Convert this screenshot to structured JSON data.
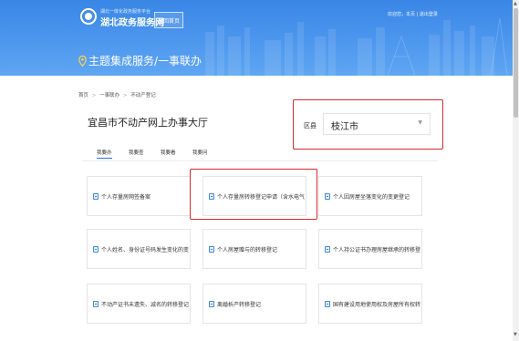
{
  "header": {
    "logo_small_text": "湖北一体化政务服务平台",
    "logo_big_text": "湖北政务服务网",
    "home_button": "返回首页",
    "top_links": "欢迎您，本页 | 退出登录",
    "service_title": "主题集成服务/一事联办"
  },
  "breadcrumb": {
    "items": [
      "首页",
      "一事联办",
      "不动产登记"
    ],
    "separator": ">"
  },
  "hall_title": "宜昌市不动产网上办事大厅",
  "region": {
    "label": "区县",
    "value": "枝江市"
  },
  "tabs": [
    "我要办",
    "我要查",
    "我要看",
    "我要问"
  ],
  "cards": [
    "个人存量房网签备案",
    "个人存量房转移登记申请（含水电气",
    "个人因房屋坐落变化的变更登记",
    "个人姓名、身份证号码发生变化的变",
    "个人房屋赠与的转移登记",
    "个人持公证书办理房屋继承的转移登",
    "不动产证书未遗失、减名的转移登记",
    "离婚析产转移登记",
    "国有建设用地使用权及房屋所有权转"
  ],
  "colors": {
    "header_blue": "#3a86e6",
    "highlight_red": "#d8282c",
    "icon_blue": "#3f86e3"
  },
  "icons": {
    "logo": "emblem-icon",
    "location": "map-pin-icon",
    "dropdown": "chevron-down-icon",
    "card": "document-icon"
  }
}
